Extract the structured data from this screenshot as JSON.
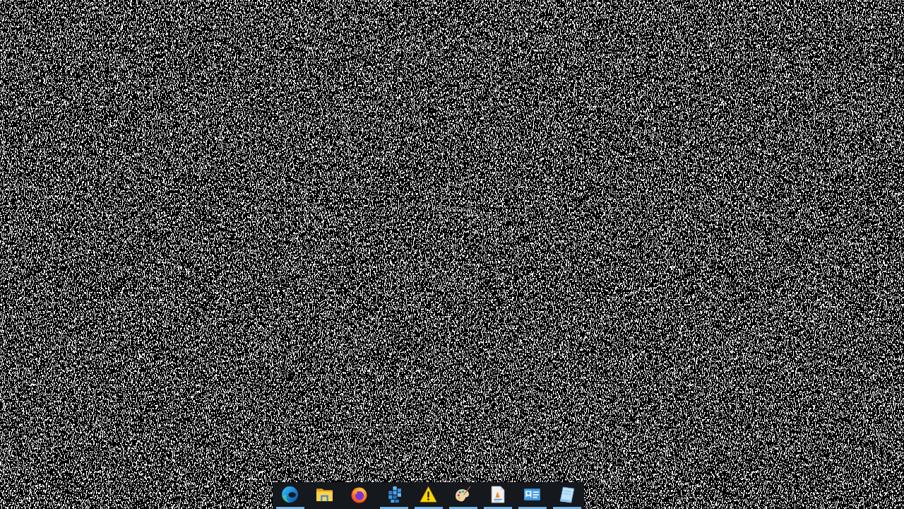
{
  "taskbar": {
    "apps": [
      {
        "kind": "swirl",
        "running": true
      },
      {
        "kind": "folder",
        "running": false
      },
      {
        "kind": "fox",
        "running": false
      },
      {
        "kind": "blocks",
        "running": true
      },
      {
        "kind": "warning",
        "running": true
      },
      {
        "kind": "palette",
        "running": true
      },
      {
        "kind": "document",
        "running": true
      },
      {
        "kind": "card",
        "running": true
      },
      {
        "kind": "notepad",
        "running": true
      }
    ]
  }
}
